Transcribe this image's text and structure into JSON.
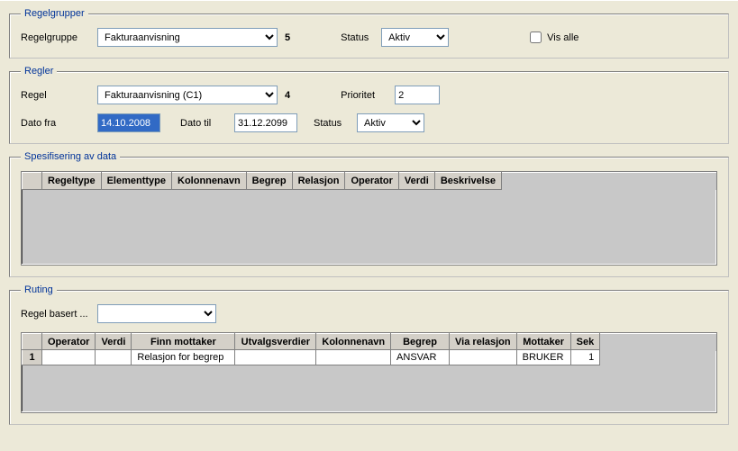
{
  "groups": {
    "regelgrupper": {
      "legend": "Regelgrupper",
      "regelgruppe_label": "Regelgruppe",
      "regelgruppe_value": "Fakturaanvisning",
      "regelgruppe_count": "5",
      "status_label": "Status",
      "status_value": "Aktiv",
      "vis_alle_label": "Vis alle"
    },
    "regler": {
      "legend": "Regler",
      "regel_label": "Regel",
      "regel_value": "Fakturaanvisning (C1)",
      "regel_count": "4",
      "prioritet_label": "Prioritet",
      "prioritet_value": "2",
      "dato_fra_label": "Dato fra",
      "dato_fra_value": "14.10.2008",
      "dato_til_label": "Dato til",
      "dato_til_value": "31.12.2099",
      "status_label": "Status",
      "status_value": "Aktiv"
    },
    "spesifisering": {
      "legend": "Spesifisering av data",
      "cols": {
        "regeltype": "Regeltype",
        "elementtype": "Elementtype",
        "kolonnenavn": "Kolonnenavn",
        "begrep": "Begrep",
        "relasjon": "Relasjon",
        "operator": "Operator",
        "verdi": "Verdi",
        "beskrivelse": "Beskrivelse"
      }
    },
    "ruting": {
      "legend": "Ruting",
      "regel_basert_label": "Regel basert ...",
      "regel_basert_value": "",
      "cols": {
        "operator": "Operator",
        "verdi": "Verdi",
        "finn_mottaker": "Finn mottaker",
        "utvalgsverdier": "Utvalgsverdier",
        "kolonnenavn": "Kolonnenavn",
        "begrep": "Begrep",
        "via_relasjon": "Via relasjon",
        "mottaker": "Mottaker",
        "sek": "Sek"
      },
      "row": {
        "index": "1",
        "operator": "",
        "verdi": "",
        "finn_mottaker": "Relasjon for begrep",
        "utvalgsverdier": "",
        "kolonnenavn": "",
        "begrep": "ANSVAR",
        "via_relasjon": "",
        "mottaker": "BRUKER",
        "sek": "1"
      }
    }
  }
}
